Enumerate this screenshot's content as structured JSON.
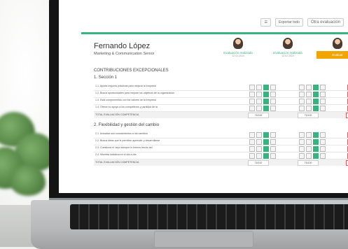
{
  "app": {
    "toolbar": {
      "menu_icon": "menu-icon",
      "export_label": "Exportar todo",
      "other_eval_label": "Otra evaluación"
    },
    "employee": {
      "name": "Fernando López",
      "role": "Marketing & Communication Senior"
    },
    "columns": [
      {
        "label": "Evaluación realizada",
        "date": "12.02.2024",
        "status": "done"
      },
      {
        "label": "Evaluación realizada",
        "date": "12.02.2024",
        "status": "done"
      },
      {
        "label": "Evaluar",
        "date": "",
        "status": "pending"
      }
    ],
    "block_title": "CONTRIBUCIONES EXCEPCIONALES",
    "sections": [
      {
        "title": "1. Sección 1",
        "rows": [
          "1.1. Aporta mejores prácticas para mejorar la empresa",
          "1.2. Busca oportunidades para mejorar los objetivos de la organización",
          "1.3. Está comprometido con los valores de la empresa",
          "1.4. Ofrece su apoyo a los compañeros y participa de la"
        ],
        "total_label": "TOTAL EVALUACIÓN COMPETENCIA",
        "scores": [
          "75/100",
          "75/100",
          ""
        ]
      },
      {
        "title": "2. Flexibilidad y gestión del cambio",
        "rows": [
          "2.1. Actualiza sus conocimientos a los cambios",
          "2.2. Busca ideas que le permiten aprender y desarrollarse",
          "2.3. Cuestiona el 'aquí siempre lo hemos hecho así'",
          "2.4. Muestra iniciativa en el día a día"
        ],
        "total_label": "TOTAL EVALUACIÓN COMPETENCIA",
        "scores": [
          "75/100",
          "75/100",
          ""
        ]
      }
    ],
    "colors": {
      "accent": "#36b37e",
      "warning": "#f0a500",
      "alert": "#e05c5c"
    }
  }
}
